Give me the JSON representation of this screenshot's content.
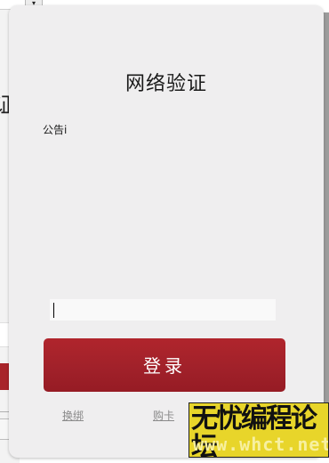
{
  "background_window": {
    "title_glyph": "证",
    "dropdown_glyph": "▾"
  },
  "dialog": {
    "title": "网络验证",
    "notice_label": "公告i",
    "key_input": {
      "value": "",
      "placeholder": ""
    },
    "login_button": "登录",
    "links": {
      "rebind": "换绑",
      "buy_card": "购卡"
    }
  },
  "watermark": {
    "line1": "无忧编程论坛",
    "line2": "www.whct.net"
  },
  "colors": {
    "dialog_bg": "#efeeef",
    "login_button": "#a8232a",
    "watermark_bg": "#e8d52a",
    "link_text": "#8a8a8a"
  }
}
